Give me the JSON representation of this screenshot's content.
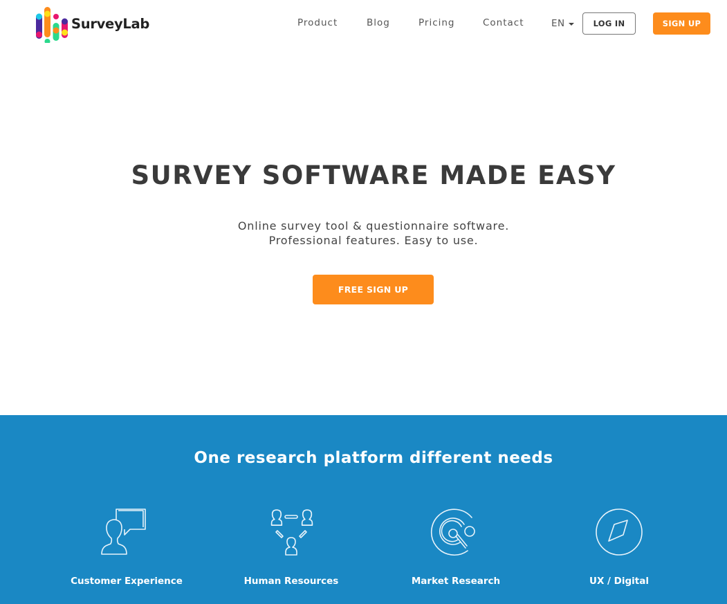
{
  "brand": {
    "name": "SurveyLab",
    "accent_color": "#fd8c1c",
    "band_color": "#1a88c4"
  },
  "nav": {
    "links": [
      "Product",
      "Blog",
      "Pricing",
      "Contact"
    ],
    "language": "EN",
    "login_label": "LOG IN",
    "signup_label": "SIGN UP"
  },
  "hero": {
    "title": "SURVEY SOFTWARE MADE EASY",
    "subtitle_line1": "Online survey tool & questionnaire software.",
    "subtitle_line2": "Professional features. Easy to use.",
    "cta_label": "FREE SIGN UP"
  },
  "features": {
    "title": "One research platform different needs",
    "items": [
      {
        "label": "Customer Experience",
        "icon": "person-speech-bubble-icon"
      },
      {
        "label": "Human Resources",
        "icon": "people-network-icon"
      },
      {
        "label": "Market Research",
        "icon": "magnifier-target-icon"
      },
      {
        "label": "UX / Digital",
        "icon": "compass-icon"
      }
    ]
  }
}
